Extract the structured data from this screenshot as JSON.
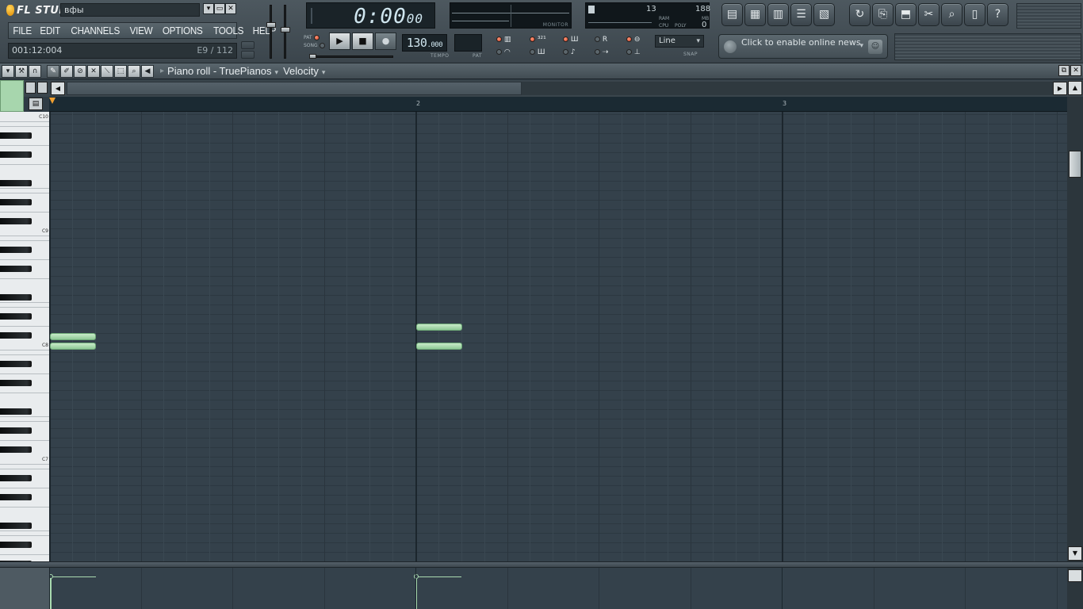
{
  "app": {
    "logo_text": "FL STUDIO",
    "project_name": "вфы"
  },
  "menu": [
    "FILE",
    "EDIT",
    "CHANNELS",
    "VIEW",
    "OPTIONS",
    "TOOLS",
    "HELP"
  ],
  "hint_bar": {
    "position": "001:12:004",
    "note_info": "E9 / 112"
  },
  "transport": {
    "time_main": "0:00",
    "time_sub": "00",
    "pat_label": "PAT",
    "song_label": "SONG",
    "tempo_main": "130",
    "tempo_frac": ".000",
    "tempo_label": "TEMPO",
    "pat_box_label": "PAT",
    "monitor_label": "MONITOR"
  },
  "cpu": {
    "value1": "13",
    "value2": "188",
    "ram_label": "RAM",
    "mb_label": "MB",
    "cpu_label": "CPU",
    "poly_label": "POLY",
    "poly_value": "0"
  },
  "snap": {
    "value": "Line",
    "label": "SNAP"
  },
  "news": {
    "text": "Click to enable online news"
  },
  "piano_roll": {
    "title": "Piano roll - TruePianos",
    "mode": "Velocity",
    "bars": [
      "2",
      "3"
    ],
    "octaves": [
      "C10",
      "C9",
      "C8",
      "C7"
    ]
  },
  "colors": {
    "note": "#a9dbb0",
    "grid_bg": "#34414b",
    "timeline_bg": "#1b2a33",
    "accent_green": "#a7d6ad"
  }
}
